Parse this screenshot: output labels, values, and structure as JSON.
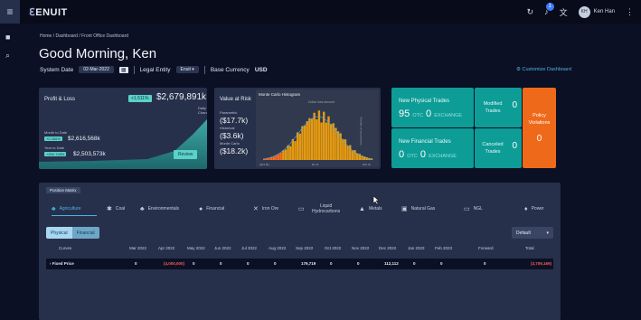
{
  "header": {
    "menu_icon": "hamburger-icon",
    "logo": "ENUIT",
    "user_name": "Ken Han",
    "user_initials": "KH",
    "notification_count": "1"
  },
  "breadcrumb": "Home / Dashboard / Front Office Dashboard",
  "greeting": "Good Morning, Ken",
  "context": {
    "system_date_label": "System Date",
    "system_date": "02-Mar-2022",
    "legal_entity_label": "Legal Entity",
    "legal_entity": "Enuit",
    "base_currency_label": "Base Currency",
    "base_currency": "USD"
  },
  "customize_label": "Customize Dashboard",
  "pl": {
    "title": "Profit & Loss",
    "change": "+1.511%",
    "value": "$2,679,891k",
    "sub": "Daily Change",
    "mtd_label": "Month to Date",
    "mtd_change": "+2.266%",
    "mtd_value": "$2,616,568k",
    "ytd_label": "Year to Date",
    "ytd_change": "+250.728%",
    "ytd_value": "$2,503,573k",
    "review": "Review"
  },
  "var": {
    "title": "Value at Risk",
    "parametric_label": "Parametric",
    "parametric": "($17.7k)",
    "historical_label": "Historical",
    "historical": "($3.6k)",
    "monte_carlo_label": "Monte Carlo",
    "monte_carlo": "($18.2k)",
    "hist_title": "Monte Carlo Histogram",
    "hist_subtitle": "Dollar loss amount",
    "hist_ylabel": "Number of occurrences",
    "hist_x_left": "($33.8k)",
    "hist_x_mid": "$0.4k",
    "hist_x_right": "$36.3k"
  },
  "trades": {
    "physical_title": "New Physical Trades",
    "physical_otc": "95",
    "physical_exchange": "0",
    "financial_title": "New Financial Trades",
    "financial_otc": "0",
    "financial_exchange": "0",
    "otc_label": "OTC",
    "exchange_label": "EXCHANGE",
    "modified_label_1": "Modified",
    "modified_label_2": "Trades",
    "modified": "0",
    "canceled_label_1": "Canceled",
    "canceled_label_2": "Trades",
    "canceled": "0",
    "policy_label_1": "Policy",
    "policy_label_2": "Violations",
    "policy": "0"
  },
  "position_matrix": {
    "tab": "Position Matrix",
    "categories": [
      {
        "label": "Agriculture",
        "icon": "agriculture-icon",
        "glyph": "♣"
      },
      {
        "label": "Coal",
        "icon": "coal-icon",
        "glyph": "✱"
      },
      {
        "label": "Environmentals",
        "icon": "environmentals-icon",
        "glyph": "♣"
      },
      {
        "label": "Financial",
        "icon": "financial-icon",
        "glyph": "●"
      },
      {
        "label": "Iron Ore",
        "icon": "iron-ore-icon",
        "glyph": "✕"
      },
      {
        "label": "Liquid Hydrocarbons",
        "icon": "liquid-hydrocarbons-icon",
        "glyph": "▭"
      },
      {
        "label": "Metals",
        "icon": "metals-icon",
        "glyph": "▲"
      },
      {
        "label": "Natural Gas",
        "icon": "natural-gas-icon",
        "glyph": "▣"
      },
      {
        "label": "NGL",
        "icon": "ngl-icon",
        "glyph": "▭"
      },
      {
        "label": "Power",
        "icon": "power-icon",
        "glyph": "♦"
      }
    ],
    "seg_physical": "Physical",
    "seg_financial": "Financial",
    "dropdown": "Default",
    "columns": [
      "Curves",
      "Mar 2022",
      "Apr 2022",
      "May 2022",
      "Jun 2022",
      "Jul 2022",
      "Aug 2022",
      "Sep 2022",
      "Oct 2022",
      "Nov 2022",
      "Dec 2022",
      "Jan 2023",
      "Feb 2023",
      "Forward",
      "Total"
    ],
    "row": {
      "label": "Fixed Price",
      "values": [
        "0",
        "(4,000,000)",
        "0",
        "0",
        "0",
        "0",
        "179,719",
        "0",
        "0",
        "112,112",
        "0",
        "0",
        "0",
        "(3,709,169)"
      ]
    }
  },
  "colors": {
    "accent_teal": "#0e9c97",
    "policy_orange": "#ee6a1a",
    "link_blue": "#4fb1e8",
    "negative_red": "#ff5a5a"
  }
}
